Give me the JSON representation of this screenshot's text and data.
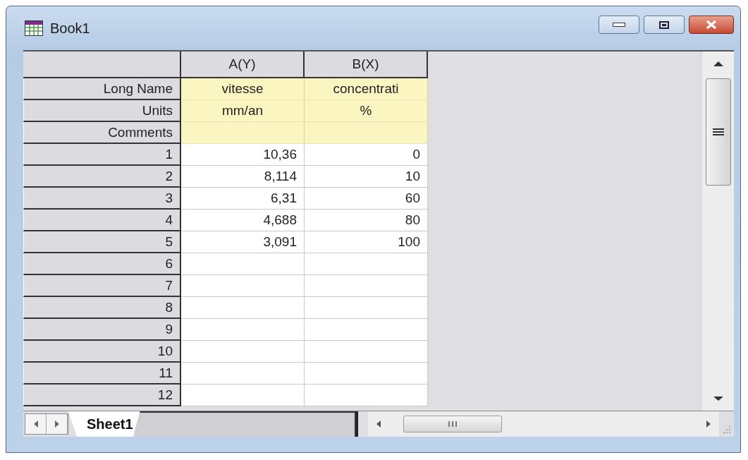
{
  "window": {
    "title": "Book1"
  },
  "columns": [
    {
      "header": "A(Y)"
    },
    {
      "header": "B(X)"
    }
  ],
  "meta_rows": [
    {
      "label": "Long Name",
      "values": [
        "vitesse",
        "concentrati"
      ]
    },
    {
      "label": "Units",
      "values": [
        "mm/an",
        "%"
      ]
    },
    {
      "label": "Comments"
    }
  ],
  "rows": [
    {
      "label": "1",
      "values": [
        "10,36",
        "0"
      ]
    },
    {
      "label": "2",
      "values": [
        "8,114",
        "10"
      ]
    },
    {
      "label": "3",
      "values": [
        "6,31",
        "60"
      ]
    },
    {
      "label": "4",
      "values": [
        "4,688",
        "80"
      ]
    },
    {
      "label": "5",
      "values": [
        "3,091",
        "100"
      ]
    },
    {
      "label": "6"
    },
    {
      "label": "7"
    },
    {
      "label": "8"
    },
    {
      "label": "9"
    },
    {
      "label": "10"
    },
    {
      "label": "11"
    },
    {
      "label": "12"
    }
  ],
  "sheet_tabs": [
    {
      "label": "Sheet1",
      "selected": true
    }
  ]
}
